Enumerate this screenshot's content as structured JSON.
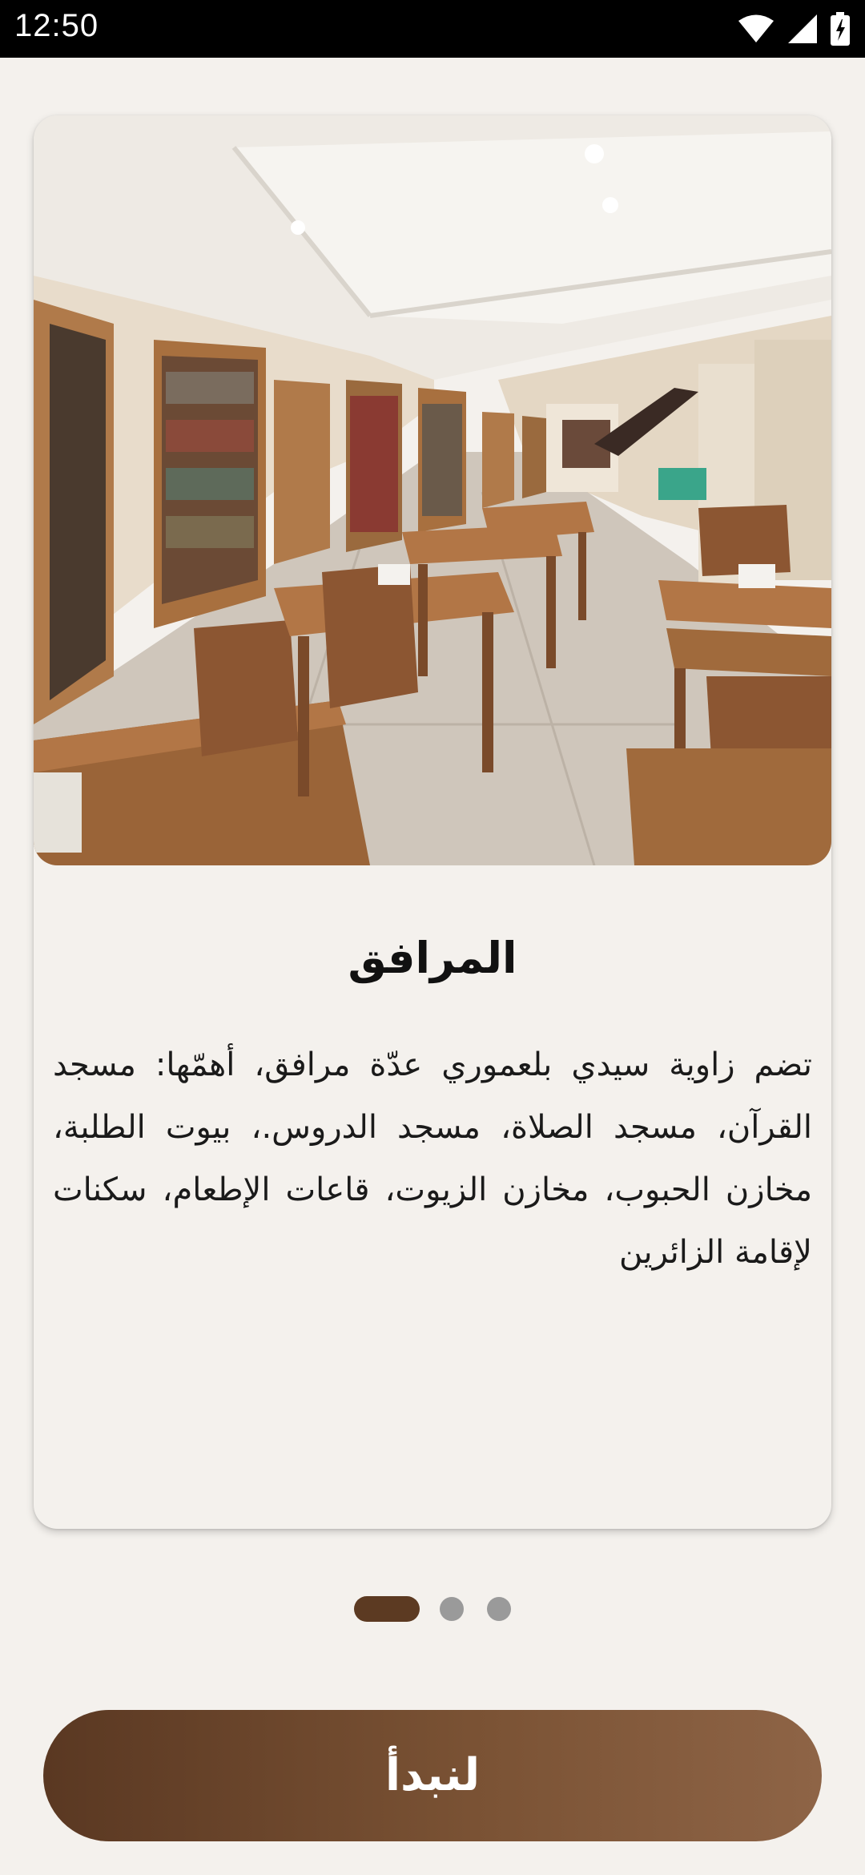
{
  "status_bar": {
    "time": "12:50",
    "icons": [
      "wifi-icon",
      "signal-icon",
      "battery-icon"
    ]
  },
  "card": {
    "image_icon": "library-reading-room-photo",
    "title": "المرافق",
    "body": "تضم زاوية سيدي بلعموري عدّة مرافق، أهمّها: مسجد القرآن، مسجد الصلاة، مسجد الدروس.، بيوت الطلبة، مخازن الحبوب، مخازن الزيوت، قاعات الإطعام، سكنات لإقامة الزائرين"
  },
  "pager": {
    "page_count": 3,
    "current_page": 1
  },
  "start_button": {
    "label": "لنبدأ"
  },
  "colors": {
    "background": "#f4f1ed",
    "accent": "#5c3a22",
    "button_gradient_start": "#5a3822",
    "button_gradient_end": "#8e6446",
    "inactive_dot": "#9a9a9a"
  }
}
